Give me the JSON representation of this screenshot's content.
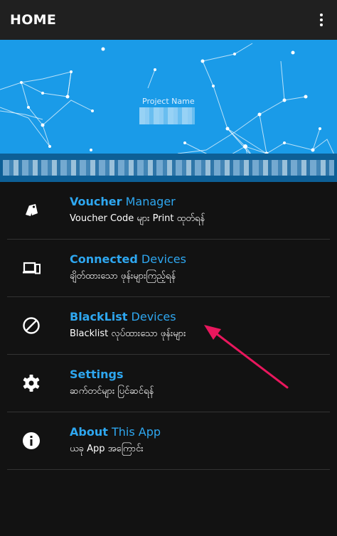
{
  "app_bar": {
    "title": "HOME",
    "overflow_icon": "more-vert-icon"
  },
  "banner": {
    "project_label": "Project Name",
    "project_value": "████████",
    "strip_text": "████████████████████████████████████████",
    "background_color": "#1a9be8",
    "strip_color": "#0d5f96"
  },
  "menu": {
    "accent_color": "#2ea7f0",
    "items": [
      {
        "bold": "Voucher",
        "rest": " Manager",
        "sub": "Voucher Code များ Print ထုတ်ရန်",
        "icon": "tag-icon"
      },
      {
        "bold": "Connected",
        "rest": " Devices",
        "sub": "ချိတ်ထားသော ဖုန်းများကြည့်ရန်",
        "icon": "devices-icon"
      },
      {
        "bold": "BlackList",
        "rest": " Devices",
        "sub": "Blacklist လုပ်ထားသော ဖုန်းများ",
        "icon": "block-icon"
      },
      {
        "bold": "Settings",
        "rest": "",
        "sub": "ဆက်တင်များ ပြင်ဆင်ရန်",
        "icon": "gear-icon"
      },
      {
        "bold": "About",
        "rest": " This App",
        "sub": "ယခု App အကြောင်း",
        "icon": "info-icon"
      }
    ]
  },
  "annotation": {
    "arrow_color": "#e8175d",
    "arrow_icon": "arrow-annotation"
  }
}
